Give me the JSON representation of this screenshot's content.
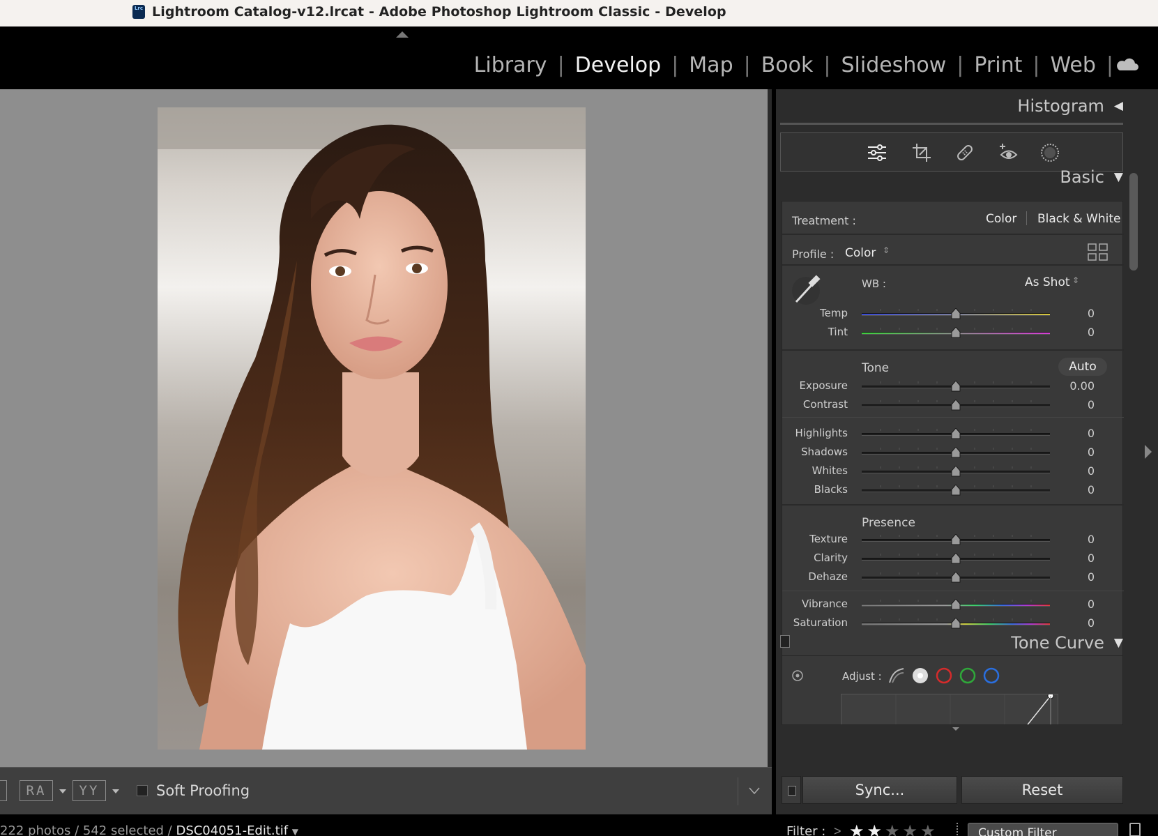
{
  "window": {
    "title": "Lightroom Catalog-v12.lrcat - Adobe Photoshop Lightroom Classic - Develop",
    "app_icon_text": "Lrc"
  },
  "modules": [
    "Library",
    "Develop",
    "Map",
    "Book",
    "Slideshow",
    "Print",
    "Web"
  ],
  "active_module": "Develop",
  "panel": {
    "histogram_label": "Histogram",
    "basic_label": "Basic",
    "tone_curve_label": "Tone Curve",
    "treatment_label": "Treatment :",
    "treatment_color": "Color",
    "treatment_bw": "Black & White",
    "profile_label": "Profile :",
    "profile_value": "Color",
    "wb_label": "WB :",
    "wb_value": "As Shot",
    "tone_label": "Tone",
    "auto_label": "Auto",
    "presence_label": "Presence",
    "adjust_label": "Adjust :",
    "sliders": [
      {
        "name": "Temp",
        "value": "0",
        "position": 0.5
      },
      {
        "name": "Tint",
        "value": "0",
        "position": 0.5
      },
      {
        "name": "Exposure",
        "value": "0.00",
        "position": 0.5
      },
      {
        "name": "Contrast",
        "value": "0",
        "position": 0.5
      },
      {
        "name": "Highlights",
        "value": "0",
        "position": 0.5
      },
      {
        "name": "Shadows",
        "value": "0",
        "position": 0.5
      },
      {
        "name": "Whites",
        "value": "0",
        "position": 0.5
      },
      {
        "name": "Blacks",
        "value": "0",
        "position": 0.5
      },
      {
        "name": "Texture",
        "value": "0",
        "position": 0.5
      },
      {
        "name": "Clarity",
        "value": "0",
        "position": 0.5
      },
      {
        "name": "Dehaze",
        "value": "0",
        "position": 0.5
      },
      {
        "name": "Vibrance",
        "value": "0",
        "position": 0.5
      },
      {
        "name": "Saturation",
        "value": "0",
        "position": 0.5
      }
    ],
    "sync_label": "Sync...",
    "reset_label": "Reset"
  },
  "toolbar": {
    "soft_proofing_label": "Soft Proofing",
    "ra_label": "RA",
    "yy_label": "YY"
  },
  "status": {
    "text": "222 photos / 542 selected / ",
    "filename": "DSC04051-Edit.tif",
    "filter_label": "Filter :",
    "filter_gt": ">",
    "rating_stars": 2,
    "rating_max": 5,
    "filter_preset": "Custom Filter"
  },
  "colors": {
    "accent_red": "#d52b2b",
    "accent_green": "#2fa83a",
    "accent_blue": "#2a6fe0"
  }
}
